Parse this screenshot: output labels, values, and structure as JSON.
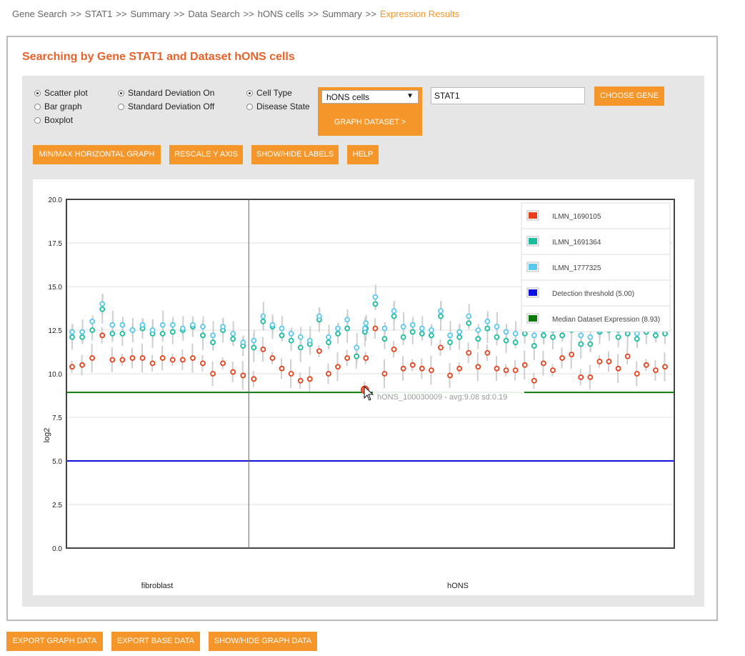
{
  "breadcrumb": {
    "items": [
      "Gene Search",
      "STAT1",
      "Summary",
      "Data Search",
      "hONS cells",
      "Summary"
    ],
    "separator": ">>",
    "current": "Expression Results"
  },
  "title": "Searching by Gene STAT1 and Dataset hONS cells",
  "controls": {
    "graph_type": {
      "options": [
        "Scatter plot",
        "Bar graph",
        "Boxplot"
      ],
      "selected": "Scatter plot"
    },
    "std_dev": {
      "options": [
        "Standard Deviation On",
        "Standard Deviation Off"
      ],
      "selected": "Standard Deviation On"
    },
    "group_by": {
      "options": [
        "Cell Type",
        "Disease State"
      ],
      "selected": "Cell Type"
    },
    "dataset_select": "hONS cells",
    "graph_dataset_label": "GRAPH DATASET >",
    "gene_input_value": "STAT1",
    "choose_gene_label": "CHOOSE GENE",
    "minmax_label": "MIN/MAX HORIZONTAL GRAPH",
    "rescale_label": "RESCALE Y AXIS",
    "labels_label": "SHOW/HIDE LABELS",
    "help_label": "HELP"
  },
  "footer": {
    "export_graph": "EXPORT GRAPH DATA",
    "export_base": "EXPORT BASE DATA",
    "show_hide_graph": "SHOW/HIDE GRAPH DATA"
  },
  "colors": {
    "accent": "#f5962a",
    "title": "#e8622a"
  },
  "chart_data": {
    "type": "scatter",
    "ylabel": "log2",
    "ylim": [
      0,
      20
    ],
    "yticks": [
      "0.0",
      "2.5",
      "5.0",
      "7.5",
      "10.0",
      "12.5",
      "15.0",
      "17.5",
      "20.0"
    ],
    "categories": [
      "fibroblast",
      "hONS"
    ],
    "category_sample_counts": [
      18,
      46
    ],
    "series": [
      {
        "name": "ILMN_1690105",
        "color": "#e8401c",
        "values": [
          10.4,
          10.5,
          10.9,
          12.2,
          10.8,
          10.8,
          10.9,
          10.9,
          10.6,
          10.9,
          10.8,
          10.8,
          10.9,
          10.6,
          10.0,
          10.6,
          10.1,
          9.9,
          9.7,
          11.4,
          10.9,
          10.3,
          10.0,
          9.6,
          9.7,
          11.3,
          10.0,
          10.4,
          10.9,
          11.0,
          10.9,
          12.6,
          10.0,
          11.4,
          10.3,
          10.5,
          10.3,
          10.2,
          11.5,
          9.9,
          10.3,
          11.2,
          10.4,
          11.2,
          10.3,
          10.2,
          10.2,
          10.5,
          9.6,
          10.6,
          10.2,
          10.9,
          11.1,
          9.8,
          9.8,
          10.7,
          10.7,
          10.3,
          11.0,
          10.0,
          10.5,
          10.2,
          10.4,
          9.08
        ]
      },
      {
        "name": "ILMN_1691364",
        "color": "#1abc9c",
        "values": [
          12.1,
          12.1,
          12.5,
          13.7,
          12.3,
          12.3,
          12.5,
          12.6,
          12.3,
          12.3,
          12.4,
          12.5,
          12.7,
          12.2,
          11.8,
          12.5,
          12.0,
          11.6,
          11.5,
          13.0,
          12.7,
          12.2,
          11.9,
          11.5,
          11.7,
          13.1,
          11.8,
          12.3,
          12.6,
          11.0,
          12.6,
          14.0,
          12.0,
          13.3,
          12.1,
          12.4,
          12.3,
          12.2,
          13.3,
          11.8,
          12.1,
          12.9,
          12.0,
          12.6,
          12.1,
          11.9,
          11.8,
          12.3,
          11.6,
          12.2,
          12.1,
          12.2,
          12.5,
          11.7,
          11.7,
          12.4,
          12.5,
          12.1,
          12.3,
          12.0,
          12.4,
          12.2,
          12.3,
          12.4
        ]
      },
      {
        "name": "ILMN_1777325",
        "color": "#5bc8f0",
        "values": [
          12.4,
          12.4,
          13.0,
          14.0,
          12.8,
          12.8,
          12.5,
          12.8,
          12.5,
          12.8,
          12.8,
          12.6,
          12.8,
          12.7,
          12.2,
          12.7,
          12.3,
          11.8,
          11.9,
          13.3,
          12.8,
          12.6,
          12.3,
          12.1,
          11.9,
          13.3,
          12.1,
          12.6,
          13.1,
          11.5,
          12.9,
          14.4,
          12.6,
          13.6,
          12.7,
          12.8,
          12.6,
          12.5,
          13.6,
          12.2,
          12.4,
          13.3,
          12.5,
          13.0,
          12.7,
          12.4,
          12.3,
          12.7,
          12.2,
          12.5,
          12.5,
          12.6,
          12.7,
          12.2,
          12.1,
          12.5,
          12.6,
          12.5,
          12.7,
          12.3,
          12.6,
          12.5,
          12.6,
          12.6
        ]
      }
    ],
    "reference_lines": [
      {
        "name": "Detection threshold (5.00)",
        "value": 5.0,
        "color": "#1010e0"
      },
      {
        "name": "Median Dataset Expression (8.93)",
        "value": 8.93,
        "color": "#0a7a0a"
      }
    ],
    "tooltip": "hONS_100030009 - avg:9.08 sd:0.19",
    "legend_position": "top-right",
    "grid": true
  }
}
